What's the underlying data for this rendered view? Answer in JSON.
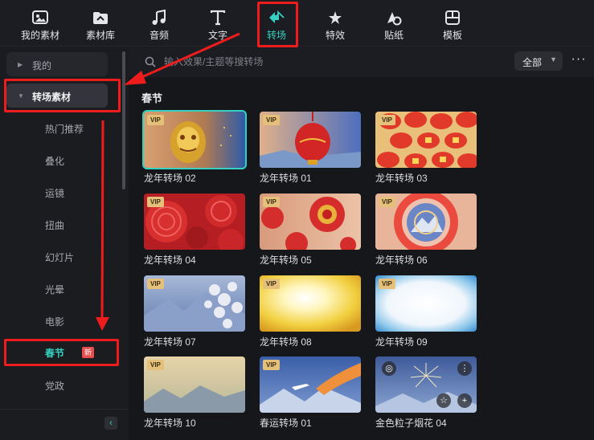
{
  "toolbar": {
    "items": [
      {
        "label": "我的素材",
        "icon": "my-assets-icon"
      },
      {
        "label": "素材库",
        "icon": "library-icon"
      },
      {
        "label": "音频",
        "icon": "music-note-icon"
      },
      {
        "label": "文字",
        "icon": "text-icon"
      },
      {
        "label": "转场",
        "icon": "transition-icon",
        "active": true
      },
      {
        "label": "特效",
        "icon": "effects-icon"
      },
      {
        "label": "贴纸",
        "icon": "sticker-icon"
      },
      {
        "label": "模板",
        "icon": "template-icon"
      }
    ],
    "accent_color": "#35d1c2"
  },
  "sidebar": {
    "mine": "我的",
    "transitions": "转场素材",
    "items": [
      "热门推荐",
      "叠化",
      "运镜",
      "扭曲",
      "幻灯片",
      "光晕",
      "电影",
      "春节",
      "党政"
    ],
    "selected": "春节",
    "new_badge": "新",
    "collapse_icon": "‹"
  },
  "search": {
    "placeholder": "输入效果/主题等搜转场",
    "filter_value": "全部",
    "more_icon": "···"
  },
  "content": {
    "section_title": "春节",
    "vip_label": "VIP",
    "cards": [
      {
        "name": "龙年转场 02",
        "vip": true,
        "selected": true
      },
      {
        "name": "龙年转场 01",
        "vip": true
      },
      {
        "name": "龙年转场 03",
        "vip": true
      },
      {
        "name": "龙年转场 04",
        "vip": true
      },
      {
        "name": "龙年转场 05",
        "vip": true
      },
      {
        "name": "龙年转场 06",
        "vip": true
      },
      {
        "name": "龙年转场 07",
        "vip": true
      },
      {
        "name": "龙年转场 08",
        "vip": true
      },
      {
        "name": "龙年转场 09",
        "vip": true
      },
      {
        "name": "龙年转场 10",
        "vip": true
      },
      {
        "name": "春运转场 01",
        "vip": true
      },
      {
        "name": "金色粒子烟花 04",
        "vip": false
      }
    ]
  },
  "annotation_color": "#ee1c1c"
}
